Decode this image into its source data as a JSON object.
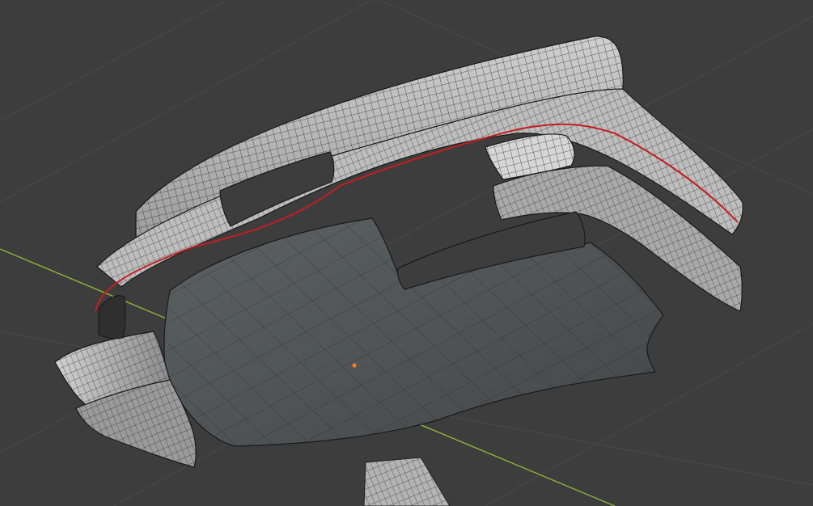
{
  "app": {
    "view": "3D Viewport",
    "shading": "solid-wireframe"
  },
  "colors": {
    "background": "#3d3d3d",
    "grid": "#484848",
    "axis_y": "#8db33a",
    "mesh_face": "#b9b9b9",
    "mesh_face_light": "#d4d4d4",
    "mesh_face_dark": "#555a5c",
    "mesh_underside": "#4a4f51",
    "wire": "#1e1e1e",
    "seam_edge": "#c41f1f",
    "origin_point": "#ff7a1a"
  },
  "scene": {
    "object": "mesh-object",
    "origin_marker": "object-origin-dot",
    "marked_edge": "red-seam-edge"
  }
}
